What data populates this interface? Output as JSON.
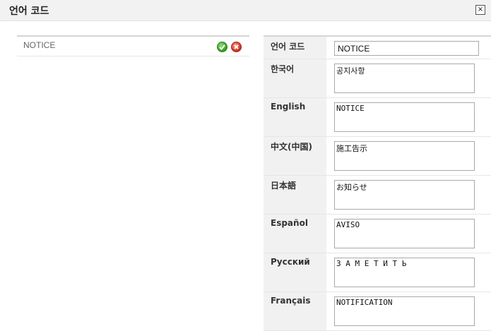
{
  "dialog": {
    "title": "언어 코드",
    "close_label": "×"
  },
  "list": {
    "items": [
      {
        "code": "NOTICE"
      }
    ]
  },
  "form": {
    "code_label": "언어 코드",
    "code_value": "NOTICE",
    "languages": [
      {
        "label": "한국어",
        "value": "공지사항"
      },
      {
        "label": "English",
        "value": "NOTICE"
      },
      {
        "label": "中文(中国)",
        "value": "施工告示"
      },
      {
        "label": "日本語",
        "value": "お知らせ"
      },
      {
        "label": "Español",
        "value": "AVISO"
      },
      {
        "label": "Русский",
        "value": "З А М Е Т И Т Ь"
      },
      {
        "label": "Français",
        "value": "NOTIFICATION"
      }
    ]
  },
  "colors": {
    "accept_icon": "#2f9a1e",
    "delete_icon": "#cc2d1c",
    "label_background": "#f1f1f1"
  }
}
